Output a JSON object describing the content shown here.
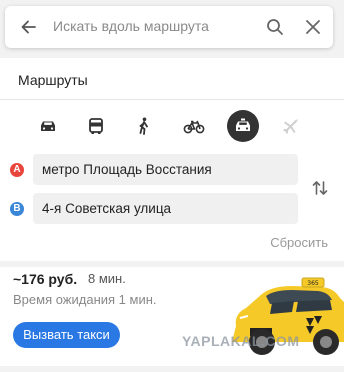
{
  "search": {
    "placeholder": "Искать вдоль маршрута"
  },
  "routes": {
    "title": "Маршруты"
  },
  "modes": [
    {
      "name": "car",
      "icon": "car-icon",
      "active": false
    },
    {
      "name": "transit",
      "icon": "bus-icon",
      "active": false
    },
    {
      "name": "walk",
      "icon": "walking-person-icon",
      "active": false
    },
    {
      "name": "bike",
      "icon": "bicycle-icon",
      "active": false
    },
    {
      "name": "taxi",
      "icon": "taxi-icon",
      "active": true
    },
    {
      "name": "plane",
      "icon": "airplane-icon",
      "active": false
    }
  ],
  "points": {
    "a": {
      "badge": "A",
      "value": "метро Площадь Восстания",
      "color": "#e8453c"
    },
    "b": {
      "badge": "B",
      "value": "4-я Советская улица",
      "color": "#3a86d9"
    }
  },
  "reset_label": "Сбросить",
  "taxi": {
    "price": "~176 руб.",
    "duration": "8 мин.",
    "wait": "Время ожидания 1 мин.",
    "call_label": "Вызвать такси",
    "brand_color": "#f5c928",
    "button_color": "#2a78e4"
  },
  "watermark": "YAPLAKAL.COM"
}
